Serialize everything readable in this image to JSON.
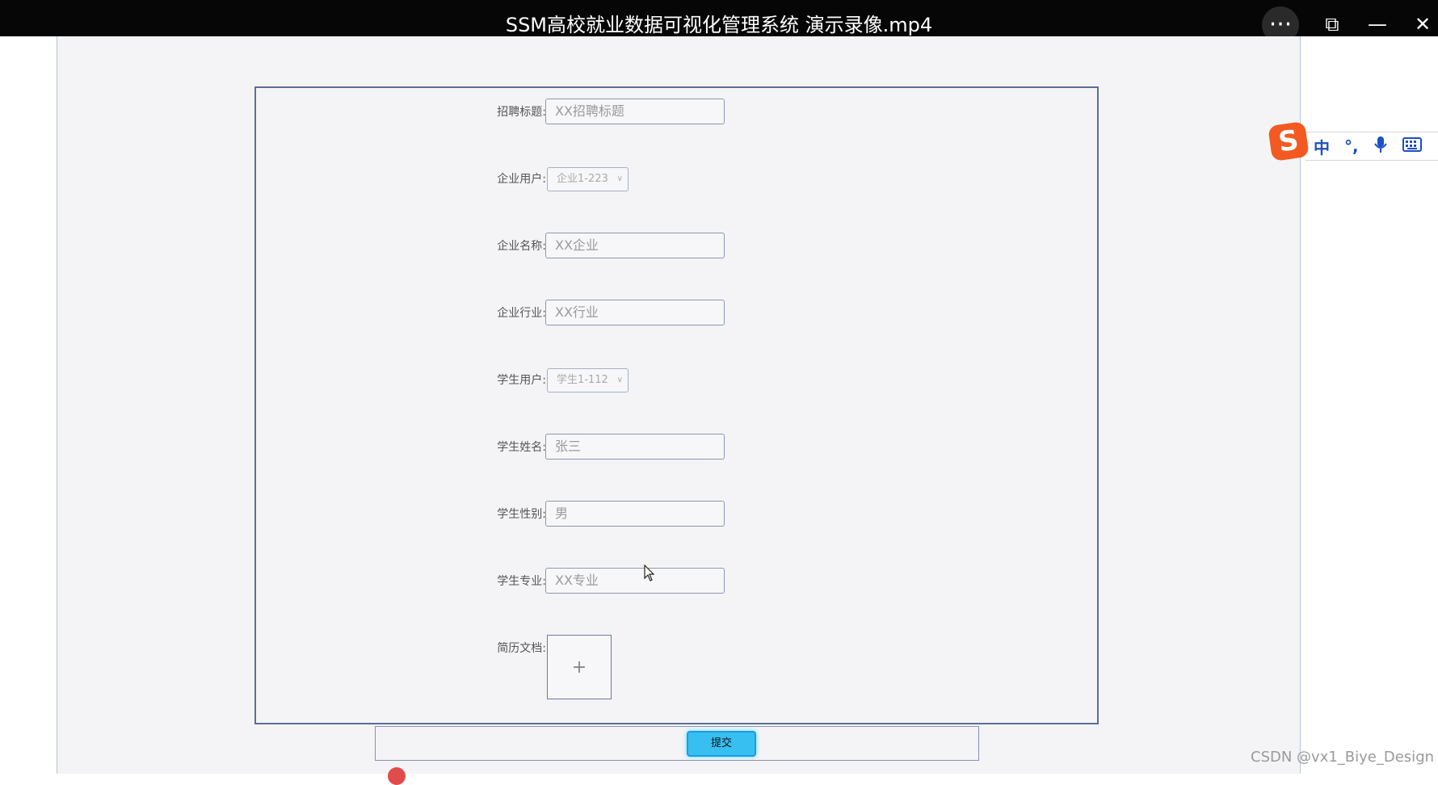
{
  "window": {
    "title": "SSM高校就业数据可视化管理系统 演示录像.mp4",
    "controls": {
      "more": "···",
      "pip": "⧉",
      "minimize": "—",
      "close": "✕"
    }
  },
  "form": {
    "fields": [
      {
        "label": "招聘标题:",
        "type": "input",
        "value": "XX招聘标题"
      },
      {
        "label": "企业用户:",
        "type": "select",
        "value": "企业1-223"
      },
      {
        "label": "企业名称:",
        "type": "input",
        "value": "XX企业"
      },
      {
        "label": "企业行业:",
        "type": "input",
        "value": "XX行业"
      },
      {
        "label": "学生用户:",
        "type": "select",
        "value": "学生1-112"
      },
      {
        "label": "学生姓名:",
        "type": "input",
        "value": "张三"
      },
      {
        "label": "学生性别:",
        "type": "input",
        "value": "男"
      },
      {
        "label": "学生专业:",
        "type": "input",
        "value": "XX专业"
      },
      {
        "label": "简历文档:",
        "type": "upload",
        "value": "+"
      }
    ],
    "submit_label": "提交"
  },
  "ime": {
    "logo": "S",
    "mode": "中",
    "punct": "°,",
    "mic": "🎤",
    "keyboard": "⌨"
  },
  "watermark": "CSDN @vx1_Biye_Design"
}
